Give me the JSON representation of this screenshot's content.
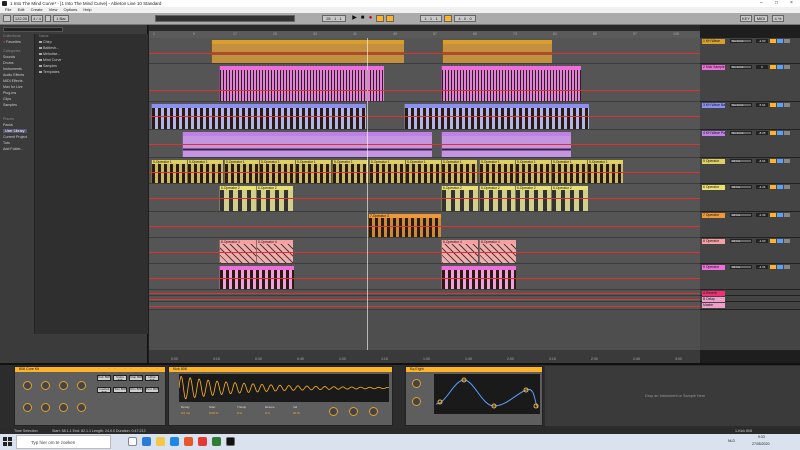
{
  "window": {
    "title": "1 Into The Mind Curve* - [1 Into The Mind Curve] - Ableton Live 10 Standard"
  },
  "menu": [
    "File",
    "Edit",
    "Create",
    "View",
    "Options",
    "Help"
  ],
  "transport": {
    "tempo": "122.00",
    "time_sig": "4 / 4",
    "quant": "1 Bar",
    "position": "25 . 1 . 1",
    "loop_start": "1 . 1 . 1",
    "loop_len": "4 . 0 . 0",
    "key": "KEY",
    "midi": "MIDI",
    "cpu": "4 %"
  },
  "browser": {
    "search_placeholder": "Search (Ctrl + F)",
    "collections_header": "Collections",
    "favorites": "Favorites",
    "categories_header": "Categories",
    "categories": [
      "Sounds",
      "Drums",
      "Instruments",
      "Audio Effects",
      "MIDI Effects",
      "Max for Live",
      "Plug-Ins",
      "Clips",
      "Samples"
    ],
    "places_header": "Places",
    "places": [
      "Packs",
      "User Library",
      "Current Project",
      "Tuts",
      "Add Folder..."
    ],
    "name_header": "Name",
    "files": [
      "Chirp",
      "Battlesh...",
      "Melodise...",
      "Mind Curve",
      "Samples",
      "Templates"
    ]
  },
  "tracks": [
    {
      "name": "1 KH Wave",
      "color": "#d99e2b",
      "io": "No Input",
      "vol": "-2.60"
    },
    {
      "name": "2 Kick Sample",
      "color": "#f06ddc",
      "io": "No Input",
      "vol": "0"
    },
    {
      "name": "3 KH Wave Bass",
      "color": "#8a8ff0",
      "io": "No Input",
      "vol": "-5.64"
    },
    {
      "name": "4 KH Wave Pad",
      "color": "#c080e8",
      "io": "No Input",
      "vol": "-8.25"
    },
    {
      "name": "5 Operator",
      "color": "#e0d060",
      "io": "All Ins",
      "vol": "-6.64"
    },
    {
      "name": "6 Operator",
      "color": "#e8e070",
      "io": "All Ins",
      "vol": "-4.24"
    },
    {
      "name": "7 Operator",
      "color": "#f09838",
      "io": "All Ins",
      "vol": "-2.39"
    },
    {
      "name": "8 Operator",
      "color": "#f8a0a0",
      "io": "All Ins",
      "vol": "-1.60"
    },
    {
      "name": "9 Operator",
      "color": "#f06ddc",
      "io": "All Ins",
      "vol": "-4.04"
    },
    {
      "name": "A Reverb",
      "color": "#f03070",
      "io": "",
      "vol": "-12"
    },
    {
      "name": "B Delay",
      "color": "#f0a0c8",
      "io": "",
      "vol": "-12"
    },
    {
      "name": "Master",
      "color": "#f0a0c8",
      "io": "",
      "vol": "0"
    }
  ],
  "clip_labels": {
    "t5": "5-Operator 1",
    "t6": "6-Operator 2",
    "t7": "7-Operator 3",
    "t8": "8-Operator 4"
  },
  "ruler_marks": [
    "1",
    "9",
    "17",
    "25",
    "33",
    "41",
    "49",
    "57",
    "65",
    "73",
    "81",
    "89",
    "97",
    "105"
  ],
  "time_marks": [
    "0:00",
    "0:15",
    "0:30",
    "0:45",
    "1:00",
    "1:15",
    "1:30",
    "1:45",
    "2:00",
    "2:15",
    "2:30",
    "2:45",
    "3:00"
  ],
  "detail": {
    "drum_rack": "808 Core Kit",
    "pads": [
      "Kick 808",
      "Snare 808",
      "Clap 808",
      "Hihat 808",
      "Cowbell 808",
      "Tom 808",
      "Rim 808",
      "Perc 808"
    ],
    "device2_title": "Kick 808",
    "device2_params": [
      "Decay",
      "Start",
      "Transp",
      "Detune",
      "Vel"
    ],
    "device2_values": [
      "0.0 ms",
      "0.00 %",
      "0 st",
      "0 ct",
      "20 %"
    ],
    "device3_title": "Eq Eight",
    "dropzone": "Drop an Instrument or Sample Here"
  },
  "status": {
    "left": "Time Selection",
    "info": "Start: 58.1.1   End: 82.1.1   Length: 24.0.0   Duration: 0:47:213",
    "right": "1-Kick 808"
  },
  "taskbar": {
    "search_placeholder": "Typ hier om te zoeken",
    "time": "9:33",
    "date": "27/05/2020",
    "lang": "NLD"
  },
  "colors": {
    "accent": "#ffb327",
    "selection": "#557"
  }
}
